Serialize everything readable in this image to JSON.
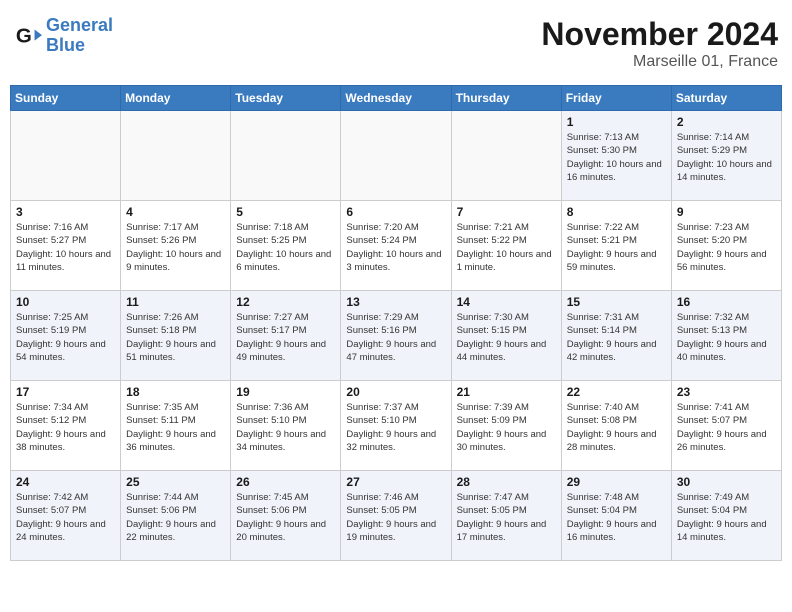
{
  "header": {
    "logo_line1": "General",
    "logo_line2": "Blue",
    "month_title": "November 2024",
    "location": "Marseille 01, France"
  },
  "weekdays": [
    "Sunday",
    "Monday",
    "Tuesday",
    "Wednesday",
    "Thursday",
    "Friday",
    "Saturday"
  ],
  "weeks": [
    [
      {
        "day": "",
        "empty": true
      },
      {
        "day": "",
        "empty": true
      },
      {
        "day": "",
        "empty": true
      },
      {
        "day": "",
        "empty": true
      },
      {
        "day": "",
        "empty": true
      },
      {
        "day": "1",
        "sunrise": "7:13 AM",
        "sunset": "5:30 PM",
        "daylight": "10 hours and 16 minutes."
      },
      {
        "day": "2",
        "sunrise": "7:14 AM",
        "sunset": "5:29 PM",
        "daylight": "10 hours and 14 minutes."
      }
    ],
    [
      {
        "day": "3",
        "sunrise": "7:16 AM",
        "sunset": "5:27 PM",
        "daylight": "10 hours and 11 minutes."
      },
      {
        "day": "4",
        "sunrise": "7:17 AM",
        "sunset": "5:26 PM",
        "daylight": "10 hours and 9 minutes."
      },
      {
        "day": "5",
        "sunrise": "7:18 AM",
        "sunset": "5:25 PM",
        "daylight": "10 hours and 6 minutes."
      },
      {
        "day": "6",
        "sunrise": "7:20 AM",
        "sunset": "5:24 PM",
        "daylight": "10 hours and 3 minutes."
      },
      {
        "day": "7",
        "sunrise": "7:21 AM",
        "sunset": "5:22 PM",
        "daylight": "10 hours and 1 minute."
      },
      {
        "day": "8",
        "sunrise": "7:22 AM",
        "sunset": "5:21 PM",
        "daylight": "9 hours and 59 minutes."
      },
      {
        "day": "9",
        "sunrise": "7:23 AM",
        "sunset": "5:20 PM",
        "daylight": "9 hours and 56 minutes."
      }
    ],
    [
      {
        "day": "10",
        "sunrise": "7:25 AM",
        "sunset": "5:19 PM",
        "daylight": "9 hours and 54 minutes."
      },
      {
        "day": "11",
        "sunrise": "7:26 AM",
        "sunset": "5:18 PM",
        "daylight": "9 hours and 51 minutes."
      },
      {
        "day": "12",
        "sunrise": "7:27 AM",
        "sunset": "5:17 PM",
        "daylight": "9 hours and 49 minutes."
      },
      {
        "day": "13",
        "sunrise": "7:29 AM",
        "sunset": "5:16 PM",
        "daylight": "9 hours and 47 minutes."
      },
      {
        "day": "14",
        "sunrise": "7:30 AM",
        "sunset": "5:15 PM",
        "daylight": "9 hours and 44 minutes."
      },
      {
        "day": "15",
        "sunrise": "7:31 AM",
        "sunset": "5:14 PM",
        "daylight": "9 hours and 42 minutes."
      },
      {
        "day": "16",
        "sunrise": "7:32 AM",
        "sunset": "5:13 PM",
        "daylight": "9 hours and 40 minutes."
      }
    ],
    [
      {
        "day": "17",
        "sunrise": "7:34 AM",
        "sunset": "5:12 PM",
        "daylight": "9 hours and 38 minutes."
      },
      {
        "day": "18",
        "sunrise": "7:35 AM",
        "sunset": "5:11 PM",
        "daylight": "9 hours and 36 minutes."
      },
      {
        "day": "19",
        "sunrise": "7:36 AM",
        "sunset": "5:10 PM",
        "daylight": "9 hours and 34 minutes."
      },
      {
        "day": "20",
        "sunrise": "7:37 AM",
        "sunset": "5:10 PM",
        "daylight": "9 hours and 32 minutes."
      },
      {
        "day": "21",
        "sunrise": "7:39 AM",
        "sunset": "5:09 PM",
        "daylight": "9 hours and 30 minutes."
      },
      {
        "day": "22",
        "sunrise": "7:40 AM",
        "sunset": "5:08 PM",
        "daylight": "9 hours and 28 minutes."
      },
      {
        "day": "23",
        "sunrise": "7:41 AM",
        "sunset": "5:07 PM",
        "daylight": "9 hours and 26 minutes."
      }
    ],
    [
      {
        "day": "24",
        "sunrise": "7:42 AM",
        "sunset": "5:07 PM",
        "daylight": "9 hours and 24 minutes."
      },
      {
        "day": "25",
        "sunrise": "7:44 AM",
        "sunset": "5:06 PM",
        "daylight": "9 hours and 22 minutes."
      },
      {
        "day": "26",
        "sunrise": "7:45 AM",
        "sunset": "5:06 PM",
        "daylight": "9 hours and 20 minutes."
      },
      {
        "day": "27",
        "sunrise": "7:46 AM",
        "sunset": "5:05 PM",
        "daylight": "9 hours and 19 minutes."
      },
      {
        "day": "28",
        "sunrise": "7:47 AM",
        "sunset": "5:05 PM",
        "daylight": "9 hours and 17 minutes."
      },
      {
        "day": "29",
        "sunrise": "7:48 AM",
        "sunset": "5:04 PM",
        "daylight": "9 hours and 16 minutes."
      },
      {
        "day": "30",
        "sunrise": "7:49 AM",
        "sunset": "5:04 PM",
        "daylight": "9 hours and 14 minutes."
      }
    ]
  ]
}
